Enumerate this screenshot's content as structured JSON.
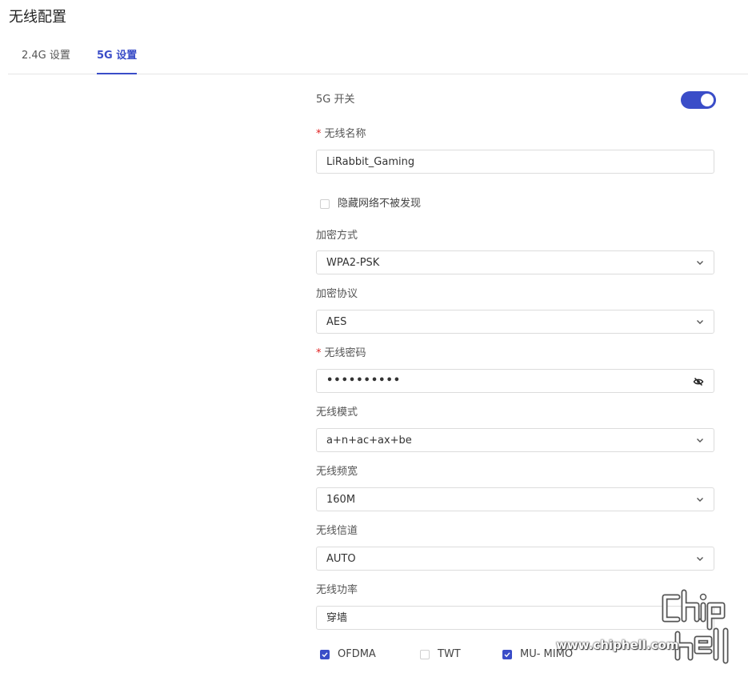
{
  "page": {
    "title": "无线配置"
  },
  "tabs": [
    {
      "label": "2.4G 设置",
      "active": false
    },
    {
      "label": "5G 设置",
      "active": true
    }
  ],
  "colors": {
    "accent": "#3a4dc8",
    "required": "#e02020",
    "border": "#dcdcdc"
  },
  "form": {
    "switch_5g": {
      "label": "5G 开关",
      "enabled": true
    },
    "ssid": {
      "label": "无线名称",
      "required": true,
      "value": "LiRabbit_Gaming"
    },
    "hide_network": {
      "label": "隐藏网络不被发现",
      "checked": false
    },
    "encryption": {
      "label": "加密方式",
      "value": "WPA2-PSK"
    },
    "protocol": {
      "label": "加密协议",
      "value": "AES"
    },
    "password": {
      "label": "无线密码",
      "required": true,
      "value": "••••••••••",
      "icon": "eye-off-icon"
    },
    "mode": {
      "label": "无线模式",
      "value": "a+n+ac+ax+be"
    },
    "bandwidth": {
      "label": "无线频宽",
      "value": "160M"
    },
    "channel": {
      "label": "无线信道",
      "value": "AUTO"
    },
    "power": {
      "label": "无线功率",
      "value": "穿墙"
    },
    "options": [
      {
        "label": "OFDMA",
        "checked": true
      },
      {
        "label": "TWT",
        "checked": false
      },
      {
        "label": "MU- MIMO",
        "checked": true
      }
    ]
  },
  "watermark": {
    "logo": "chip hell",
    "url": "www.chiphell.com"
  }
}
